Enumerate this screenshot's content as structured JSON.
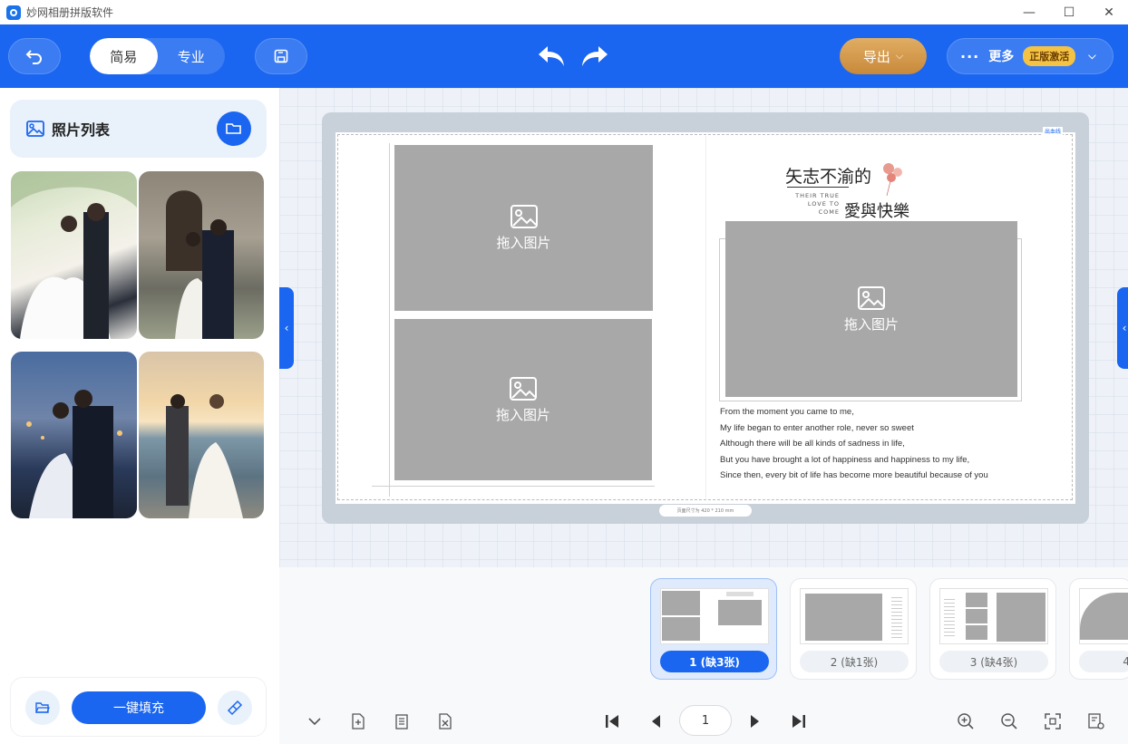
{
  "window": {
    "title": "妙网相册拼版软件",
    "minimize": "—",
    "maximize": "☐",
    "close": "✕"
  },
  "toolbar": {
    "mode_simple": "简易",
    "mode_pro": "专业",
    "export_label": "导出",
    "more_label": "更多",
    "activate_badge": "正版激活"
  },
  "photo_panel": {
    "title": "照片列表",
    "fill_button": "一键填充"
  },
  "page": {
    "slot_label": "拖入图片",
    "heading_main": "矢志不渝的",
    "heading_sub": "愛與快樂",
    "tagline_1": "THEIR TRUE",
    "tagline_2": "LOVE TO",
    "tagline_3": "COME",
    "bleed_label": "出血线",
    "size_note": "页面尺寸为 420 * 210 mm",
    "poem": [
      "From the moment you came to me,",
      "My life began to enter another role, never so sweet",
      "Although there will be all kinds of sadness in life,",
      "But you have brought a lot of happiness and happiness to my life,",
      "Since then, every bit of life has become more beautiful because of you"
    ]
  },
  "pages_strip": [
    {
      "label": "1 (缺3张)",
      "selected": true
    },
    {
      "label": "2 (缺1张)",
      "selected": false
    },
    {
      "label": "3 (缺4张)",
      "selected": false
    },
    {
      "label": "4",
      "selected": false
    }
  ],
  "pager": {
    "current": "1"
  },
  "colors": {
    "brand": "#1a66f0",
    "export": "#d49a4c",
    "badge": "#f5c344"
  }
}
